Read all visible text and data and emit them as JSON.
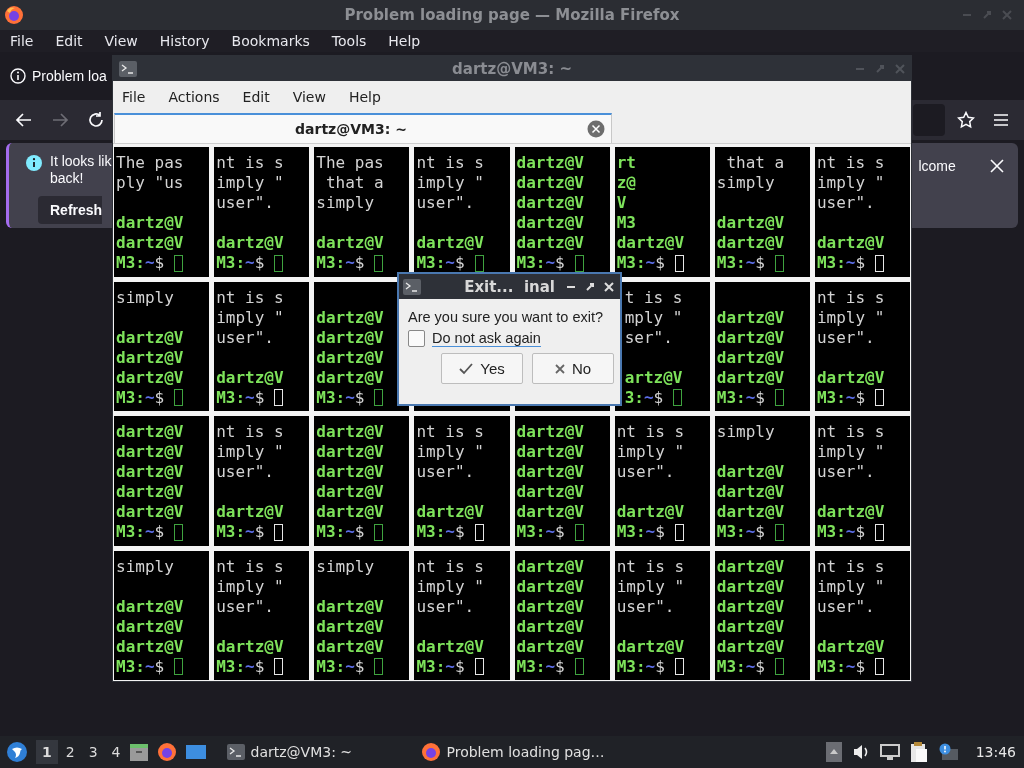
{
  "firefox": {
    "title": "Problem loading page — Mozilla Firefox",
    "menu": [
      "File",
      "Edit",
      "View",
      "History",
      "Bookmarks",
      "Tools",
      "Help"
    ],
    "tab": {
      "label": "Problem loa"
    },
    "nav": {
      "back_disabled": false,
      "forward_disabled": true
    },
    "notification": {
      "lines": [
        "It looks lik",
        "back!"
      ],
      "text_right": "lcome",
      "button": "Refresh"
    }
  },
  "terminal": {
    "title": "dartz@VM3: ~",
    "menu": [
      "File",
      "Actions",
      "Edit",
      "View",
      "Help"
    ],
    "tab": {
      "label": "dartz@VM3: ~",
      "selected": true
    },
    "rows": [
      [
        {
          "lines": [
            {
              "kind": "text",
              "text": "The pas"
            },
            {
              "kind": "text",
              "text": "ply \"us"
            },
            {
              "kind": "blank"
            },
            {
              "kind": "prompt",
              "text": "dartz@V"
            },
            {
              "kind": "prompt",
              "text": "dartz@V"
            },
            {
              "kind": "tail",
              "host": "M3:",
              "path": "~",
              "sign": "$",
              "color": "#3fa33f"
            }
          ]
        },
        {
          "lines": [
            {
              "kind": "text",
              "text": "nt is s"
            },
            {
              "kind": "text",
              "text": "imply \""
            },
            {
              "kind": "text",
              "text": "user\"."
            },
            {
              "kind": "blank"
            },
            {
              "kind": "prompt",
              "text": "dartz@V"
            },
            {
              "kind": "tail",
              "host": "M3:",
              "path": "~",
              "sign": "$",
              "color": "#3fa33f"
            }
          ]
        },
        {
          "lines": [
            {
              "kind": "text",
              "text": "The pas"
            },
            {
              "kind": "text",
              "text": " that a"
            },
            {
              "kind": "text",
              "text": "simply"
            },
            {
              "kind": "blank"
            },
            {
              "kind": "prompt",
              "text": "dartz@V"
            },
            {
              "kind": "tail",
              "host": "M3:",
              "path": "~",
              "sign": "$",
              "color": "#3fa33f"
            }
          ]
        },
        {
          "lines": [
            {
              "kind": "text",
              "text": "nt is s"
            },
            {
              "kind": "text",
              "text": "imply \""
            },
            {
              "kind": "text",
              "text": "user\"."
            },
            {
              "kind": "blank"
            },
            {
              "kind": "prompt",
              "text": "dartz@V"
            },
            {
              "kind": "tail",
              "host": "M3:",
              "path": "~",
              "sign": "$",
              "color": "#3fa33f"
            }
          ]
        },
        {
          "lines": [
            {
              "kind": "prompt",
              "text": "dartz@V"
            },
            {
              "kind": "prompt",
              "text": "dartz@V"
            },
            {
              "kind": "prompt",
              "text": "dartz@V"
            },
            {
              "kind": "prompt",
              "text": "dartz@V"
            },
            {
              "kind": "prompt",
              "text": "dartz@V"
            },
            {
              "kind": "tail",
              "host": "M3:",
              "path": "~",
              "sign": "$",
              "color": "#3fa33f"
            }
          ]
        },
        {
          "lines": [
            {
              "kind": "prompt",
              "text": "rt"
            },
            {
              "kind": "prompt",
              "text": "z@"
            },
            {
              "kind": "prompt",
              "text": "V"
            },
            {
              "kind": "prompt",
              "text": "M3"
            },
            {
              "kind": "prompt",
              "text": "dartz@V"
            },
            {
              "kind": "tail",
              "host": "M3:",
              "path": "~",
              "sign": "$",
              "color": "#e6e6e6"
            }
          ]
        },
        {
          "lines": [
            {
              "kind": "text",
              "text": " that a"
            },
            {
              "kind": "text",
              "text": "simply"
            },
            {
              "kind": "blank"
            },
            {
              "kind": "prompt",
              "text": "dartz@V"
            },
            {
              "kind": "prompt",
              "text": "dartz@V"
            },
            {
              "kind": "tail",
              "host": "M3:",
              "path": "~",
              "sign": "$",
              "color": "#3fa33f"
            }
          ]
        },
        {
          "lines": [
            {
              "kind": "text",
              "text": "nt is s"
            },
            {
              "kind": "text",
              "text": "imply \""
            },
            {
              "kind": "text",
              "text": "user\"."
            },
            {
              "kind": "blank"
            },
            {
              "kind": "prompt",
              "text": "dartz@V"
            },
            {
              "kind": "tail",
              "host": "M3:",
              "path": "~",
              "sign": "$",
              "color": "#e6e6e6"
            }
          ]
        }
      ],
      [
        {
          "lines": [
            {
              "kind": "text",
              "text": "simply"
            },
            {
              "kind": "blank"
            },
            {
              "kind": "prompt",
              "text": "dartz@V"
            },
            {
              "kind": "prompt",
              "text": "dartz@V"
            },
            {
              "kind": "prompt",
              "text": "dartz@V"
            },
            {
              "kind": "tail",
              "host": "M3:",
              "path": "~",
              "sign": "$",
              "color": "#3fa33f"
            }
          ]
        },
        {
          "lines": [
            {
              "kind": "text",
              "text": "nt is s"
            },
            {
              "kind": "text",
              "text": "imply \""
            },
            {
              "kind": "text",
              "text": "user\"."
            },
            {
              "kind": "blank"
            },
            {
              "kind": "prompt",
              "text": "dartz@V"
            },
            {
              "kind": "tail",
              "host": "M3:",
              "path": "~",
              "sign": "$",
              "color": "#e6e6e6"
            }
          ]
        },
        {
          "lines": [
            {
              "kind": "blank"
            },
            {
              "kind": "prompt",
              "text": "dartz@V"
            },
            {
              "kind": "prompt",
              "text": "dartz@V"
            },
            {
              "kind": "prompt",
              "text": "dartz@V"
            },
            {
              "kind": "prompt",
              "text": "dartz@V"
            },
            {
              "kind": "tail",
              "host": "M3:",
              "path": "~",
              "sign": "$",
              "color": "#3fa33f"
            }
          ]
        },
        {},
        {},
        {
          "clipped_left": true,
          "lines": [
            {
              "kind": "text",
              "text": "t is s"
            },
            {
              "kind": "text",
              "text": "mply \""
            },
            {
              "kind": "text",
              "text": "ser\"."
            },
            {
              "kind": "blank"
            },
            {
              "kind": "prompt",
              "text": "artz@V"
            },
            {
              "kind": "tail",
              "host": "3:",
              "path": "~",
              "sign": "$",
              "color": "#3fa33f"
            }
          ]
        },
        {
          "lines": [
            {
              "kind": "blank"
            },
            {
              "kind": "prompt",
              "text": "dartz@V"
            },
            {
              "kind": "prompt",
              "text": "dartz@V"
            },
            {
              "kind": "prompt",
              "text": "dartz@V"
            },
            {
              "kind": "prompt",
              "text": "dartz@V"
            },
            {
              "kind": "tail",
              "host": "M3:",
              "path": "~",
              "sign": "$",
              "color": "#3fa33f"
            }
          ]
        },
        {
          "lines": [
            {
              "kind": "text",
              "text": "nt is s"
            },
            {
              "kind": "text",
              "text": "imply \""
            },
            {
              "kind": "text",
              "text": "user\"."
            },
            {
              "kind": "blank"
            },
            {
              "kind": "prompt",
              "text": "dartz@V"
            },
            {
              "kind": "tail",
              "host": "M3:",
              "path": "~",
              "sign": "$",
              "color": "#e6e6e6"
            }
          ]
        }
      ],
      [
        {
          "lines": [
            {
              "kind": "prompt",
              "text": "dartz@V"
            },
            {
              "kind": "prompt",
              "text": "dartz@V"
            },
            {
              "kind": "prompt",
              "text": "dartz@V"
            },
            {
              "kind": "prompt",
              "text": "dartz@V"
            },
            {
              "kind": "prompt",
              "text": "dartz@V"
            },
            {
              "kind": "tail",
              "host": "M3:",
              "path": "~",
              "sign": "$",
              "color": "#3fa33f"
            }
          ]
        },
        {
          "lines": [
            {
              "kind": "text",
              "text": "nt is s"
            },
            {
              "kind": "text",
              "text": "imply \""
            },
            {
              "kind": "text",
              "text": "user\"."
            },
            {
              "kind": "blank"
            },
            {
              "kind": "prompt",
              "text": "dartz@V"
            },
            {
              "kind": "tail",
              "host": "M3:",
              "path": "~",
              "sign": "$",
              "color": "#e6e6e6"
            }
          ]
        },
        {
          "lines": [
            {
              "kind": "prompt",
              "text": "dartz@V"
            },
            {
              "kind": "prompt",
              "text": "dartz@V"
            },
            {
              "kind": "prompt",
              "text": "dartz@V"
            },
            {
              "kind": "prompt",
              "text": "dartz@V"
            },
            {
              "kind": "prompt",
              "text": "dartz@V"
            },
            {
              "kind": "tail",
              "host": "M3:",
              "path": "~",
              "sign": "$",
              "color": "#3fa33f"
            }
          ]
        },
        {
          "lines": [
            {
              "kind": "text",
              "text": "nt is s"
            },
            {
              "kind": "text",
              "text": "imply \""
            },
            {
              "kind": "text",
              "text": "user\"."
            },
            {
              "kind": "blank"
            },
            {
              "kind": "prompt",
              "text": "dartz@V"
            },
            {
              "kind": "tail",
              "host": "M3:",
              "path": "~",
              "sign": "$",
              "color": "#e6e6e6"
            }
          ]
        },
        {
          "lines": [
            {
              "kind": "prompt",
              "text": "dartz@V"
            },
            {
              "kind": "prompt",
              "text": "dartz@V"
            },
            {
              "kind": "prompt",
              "text": "dartz@V"
            },
            {
              "kind": "prompt",
              "text": "dartz@V"
            },
            {
              "kind": "prompt",
              "text": "dartz@V"
            },
            {
              "kind": "tail",
              "host": "M3:",
              "path": "~",
              "sign": "$",
              "color": "#3fa33f"
            }
          ]
        },
        {
          "lines": [
            {
              "kind": "text",
              "text": "nt is s"
            },
            {
              "kind": "text",
              "text": "imply \""
            },
            {
              "kind": "text",
              "text": "user\"."
            },
            {
              "kind": "blank"
            },
            {
              "kind": "prompt",
              "text": "dartz@V"
            },
            {
              "kind": "tail",
              "host": "M3:",
              "path": "~",
              "sign": "$",
              "color": "#e6e6e6"
            }
          ]
        },
        {
          "lines": [
            {
              "kind": "text",
              "text": "simply"
            },
            {
              "kind": "blank"
            },
            {
              "kind": "prompt",
              "text": "dartz@V"
            },
            {
              "kind": "prompt",
              "text": "dartz@V"
            },
            {
              "kind": "prompt",
              "text": "dartz@V"
            },
            {
              "kind": "tail",
              "host": "M3:",
              "path": "~",
              "sign": "$",
              "color": "#3fa33f"
            }
          ]
        },
        {
          "lines": [
            {
              "kind": "text",
              "text": "nt is s"
            },
            {
              "kind": "text",
              "text": "imply \""
            },
            {
              "kind": "text",
              "text": "user\"."
            },
            {
              "kind": "blank"
            },
            {
              "kind": "prompt",
              "text": "dartz@V"
            },
            {
              "kind": "tail",
              "host": "M3:",
              "path": "~",
              "sign": "$",
              "color": "#e6e6e6"
            }
          ]
        }
      ],
      [
        {
          "lines": [
            {
              "kind": "text",
              "text": "simply"
            },
            {
              "kind": "blank"
            },
            {
              "kind": "prompt",
              "text": "dartz@V"
            },
            {
              "kind": "prompt",
              "text": "dartz@V"
            },
            {
              "kind": "prompt",
              "text": "dartz@V"
            },
            {
              "kind": "tail",
              "host": "M3:",
              "path": "~",
              "sign": "$",
              "color": "#3fa33f"
            }
          ]
        },
        {
          "lines": [
            {
              "kind": "text",
              "text": "nt is s"
            },
            {
              "kind": "text",
              "text": "imply \""
            },
            {
              "kind": "text",
              "text": "user\"."
            },
            {
              "kind": "blank"
            },
            {
              "kind": "prompt",
              "text": "dartz@V"
            },
            {
              "kind": "tail",
              "host": "M3:",
              "path": "~",
              "sign": "$",
              "color": "#e6e6e6"
            }
          ]
        },
        {
          "lines": [
            {
              "kind": "text",
              "text": "simply"
            },
            {
              "kind": "blank"
            },
            {
              "kind": "prompt",
              "text": "dartz@V"
            },
            {
              "kind": "prompt",
              "text": "dartz@V"
            },
            {
              "kind": "prompt",
              "text": "dartz@V"
            },
            {
              "kind": "tail",
              "host": "M3:",
              "path": "~",
              "sign": "$",
              "color": "#3fa33f"
            }
          ]
        },
        {
          "lines": [
            {
              "kind": "text",
              "text": "nt is s"
            },
            {
              "kind": "text",
              "text": "imply \""
            },
            {
              "kind": "text",
              "text": "user\"."
            },
            {
              "kind": "blank"
            },
            {
              "kind": "prompt",
              "text": "dartz@V"
            },
            {
              "kind": "tail",
              "host": "M3:",
              "path": "~",
              "sign": "$",
              "color": "#e6e6e6"
            }
          ]
        },
        {
          "lines": [
            {
              "kind": "prompt",
              "text": "dartz@V"
            },
            {
              "kind": "prompt",
              "text": "dartz@V"
            },
            {
              "kind": "prompt",
              "text": "dartz@V"
            },
            {
              "kind": "prompt",
              "text": "dartz@V"
            },
            {
              "kind": "prompt",
              "text": "dartz@V"
            },
            {
              "kind": "tail",
              "host": "M3:",
              "path": "~",
              "sign": "$",
              "color": "#3fa33f"
            }
          ]
        },
        {
          "lines": [
            {
              "kind": "text",
              "text": "nt is s"
            },
            {
              "kind": "text",
              "text": "imply \""
            },
            {
              "kind": "text",
              "text": "user\"."
            },
            {
              "kind": "blank"
            },
            {
              "kind": "prompt",
              "text": "dartz@V"
            },
            {
              "kind": "tail",
              "host": "M3:",
              "path": "~",
              "sign": "$",
              "color": "#e6e6e6"
            }
          ]
        },
        {
          "lines": [
            {
              "kind": "prompt",
              "text": "dartz@V"
            },
            {
              "kind": "prompt",
              "text": "dartz@V"
            },
            {
              "kind": "prompt",
              "text": "dartz@V"
            },
            {
              "kind": "prompt",
              "text": "dartz@V"
            },
            {
              "kind": "prompt",
              "text": "dartz@V"
            },
            {
              "kind": "tail",
              "host": "M3:",
              "path": "~",
              "sign": "$",
              "color": "#3fa33f"
            }
          ]
        },
        {
          "lines": [
            {
              "kind": "text",
              "text": "nt is s"
            },
            {
              "kind": "text",
              "text": "imply \""
            },
            {
              "kind": "text",
              "text": "user\"."
            },
            {
              "kind": "blank"
            },
            {
              "kind": "prompt",
              "text": "dartz@V"
            },
            {
              "kind": "tail",
              "host": "M3:",
              "path": "~",
              "sign": "$",
              "color": "#e6e6e6"
            }
          ]
        }
      ]
    ]
  },
  "dialog": {
    "title": "Exit...  inal",
    "message": "Are you sure you want to exit?",
    "checkbox": {
      "label": "Do not ask again",
      "checked": false
    },
    "buttons": [
      {
        "kind": "yes",
        "label": "Yes"
      },
      {
        "kind": "no",
        "label": "No"
      }
    ]
  },
  "taskbar": {
    "workspaces": [
      {
        "label": "1",
        "selected": true
      },
      {
        "label": "2",
        "selected": false
      },
      {
        "label": "3",
        "selected": false
      },
      {
        "label": "4",
        "selected": false
      }
    ],
    "tasks": [
      {
        "kind": "terminal",
        "label": "dartz@VM3: ~"
      },
      {
        "kind": "firefox",
        "label": "Problem loading pag…"
      }
    ],
    "clock": "13:46"
  }
}
